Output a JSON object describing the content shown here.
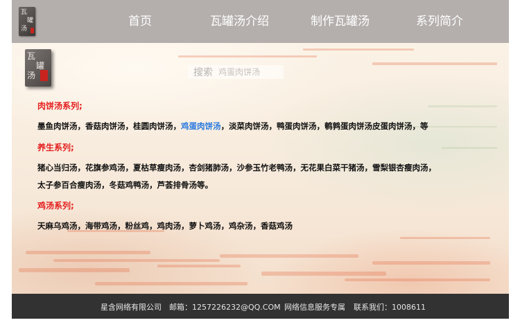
{
  "nav": {
    "logo_chars": [
      "瓦",
      "罐",
      "汤"
    ],
    "items": [
      {
        "label": "首页"
      },
      {
        "label": "瓦罐汤介绍"
      },
      {
        "label": "制作瓦罐汤"
      },
      {
        "label": "系列简介"
      }
    ]
  },
  "side_logo": {
    "chars": [
      "瓦",
      "罐",
      "汤"
    ]
  },
  "search": {
    "label": "搜索",
    "placeholder": "鸡蛋肉饼汤"
  },
  "sections": [
    {
      "title": "肉饼汤系列;",
      "lines": [
        {
          "before": "墨鱼肉饼汤，香菇肉饼汤，桂圆肉饼汤，",
          "link": "鸡蛋肉饼汤",
          "after": "，淡菜肉饼汤，鸭蛋肉饼汤，鹌鹑蛋肉饼汤皮蛋肉饼汤，等"
        }
      ]
    },
    {
      "title": "养生系列;",
      "lines": [
        {
          "text": "猪心当归汤，花旗参鸡汤，夏枯草瘦肉汤，杏剑猪肺汤，沙参玉竹老鸭汤，无花果白菜干猪汤，雪梨银杏瘦肉汤，"
        },
        {
          "text": "太子参百合瘦肉汤，冬菇鸡鸭汤，芦荟排骨汤等。"
        }
      ]
    },
    {
      "title": "鸡汤系列;",
      "lines": [
        {
          "text": "天麻乌鸡汤，海带鸡汤，粉丝鸡，鸡肉汤，萝卜鸡汤，鸡杂汤，香菇鸡汤"
        }
      ]
    }
  ],
  "footer": {
    "company": "星含网络有限公司",
    "email": "邮箱：1257226232@QQ.COM",
    "service": "网络信息服务专属",
    "contact": "联系我们：1008611"
  },
  "colors": {
    "nav_bg": "#b4afad",
    "section_title": "#e41e1e",
    "link": "#2a79e0",
    "footer_bg": "#333232"
  }
}
